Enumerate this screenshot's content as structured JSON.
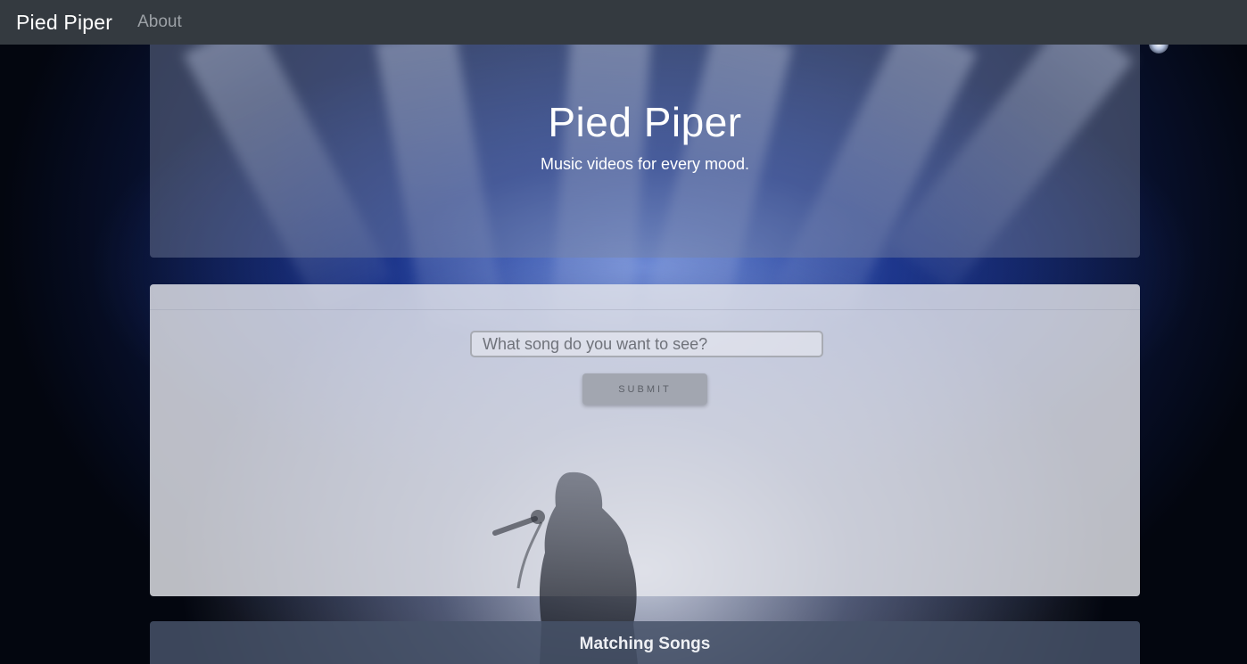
{
  "navbar": {
    "brand": "Pied Piper",
    "links": [
      {
        "label": "About"
      }
    ]
  },
  "hero": {
    "title": "Pied Piper",
    "subtitle": "Music videos for every mood."
  },
  "search": {
    "placeholder": "What song do you want to see?",
    "value": "",
    "submit_label": "SUBMIT"
  },
  "results": {
    "title": "Matching Songs"
  },
  "colors": {
    "navbar_bg": "#343a40",
    "stage_blue": "#1b3a86",
    "submit_bg": "#a2a6b0"
  },
  "icons": {
    "background": "stage-lights-concert-image"
  }
}
